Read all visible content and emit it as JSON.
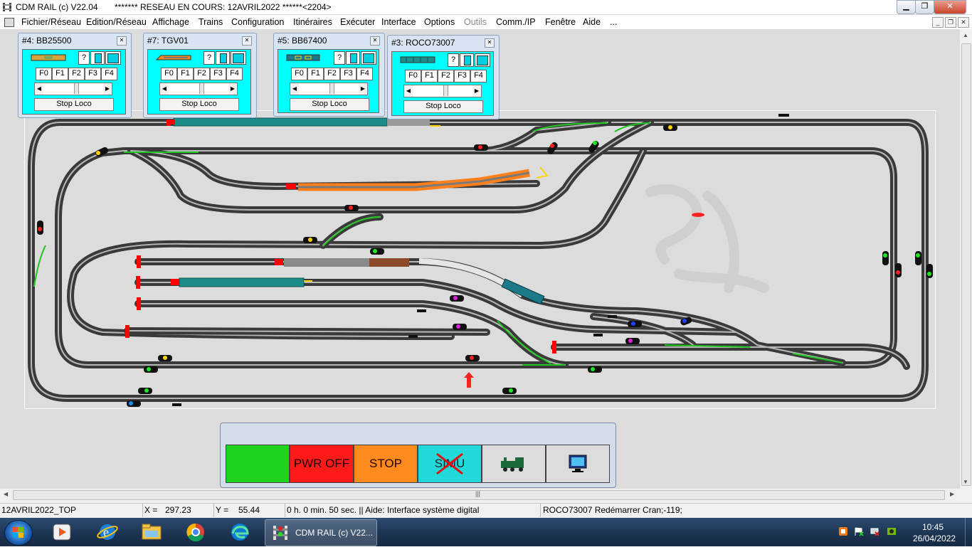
{
  "window": {
    "title": "CDM RAIL (c) V22.04",
    "network_status": "******* RESEAU EN COURS: 12AVRIL2022 ******<2204>"
  },
  "menu": [
    "Fichier/Réseau",
    "Edition/Réseau",
    "Affichage",
    "Trains",
    "Configuration",
    "Itinéraires",
    "Exécuter",
    "Interface",
    "Options",
    "Outils",
    "Comm./IP",
    "Fenêtre",
    "Aide",
    "..."
  ],
  "loco_windows": [
    {
      "title": "#4: BB25500",
      "f_buttons": [
        "F0",
        "F1",
        "F2",
        "F3",
        "F4"
      ],
      "help": "?",
      "stop_label": "Stop Loco"
    },
    {
      "title": "#7: TGV01",
      "f_buttons": [
        "F0",
        "F1",
        "F2",
        "F3",
        "F4"
      ],
      "help": "?",
      "stop_label": "Stop Loco"
    },
    {
      "title": "#5: BB67400",
      "f_buttons": [
        "F0",
        "F1",
        "F2",
        "F3",
        "F4"
      ],
      "help": "?",
      "stop_label": "Stop Loco"
    },
    {
      "title": "#3: ROCO73007",
      "f_buttons": [
        "F0",
        "F1",
        "F2",
        "F3",
        "F4"
      ],
      "help": "?",
      "stop_label": "Stop Loco"
    }
  ],
  "controls": {
    "power_off": "PWR OFF",
    "stop": "STOP",
    "simu": "SIMU",
    "colors": {
      "go": "#1ed21e",
      "power": "#ff1a1a",
      "stop": "#ff8a1e",
      "simu": "#22d8d8"
    }
  },
  "status": {
    "network": "12AVRIL2022_TOP",
    "x_label": "X =",
    "x_value": "297.23",
    "y_label": "Y =",
    "y_value": "55.44",
    "time_help": "0 h. 0 min. 50 sec.  || Aide: Interface système digital",
    "train_info": "ROCO73007 Redémarrer Cran;-119;"
  },
  "taskbar": {
    "active_app": "CDM RAIL (c) V22...",
    "time": "10:45",
    "date": "26/04/2022"
  }
}
